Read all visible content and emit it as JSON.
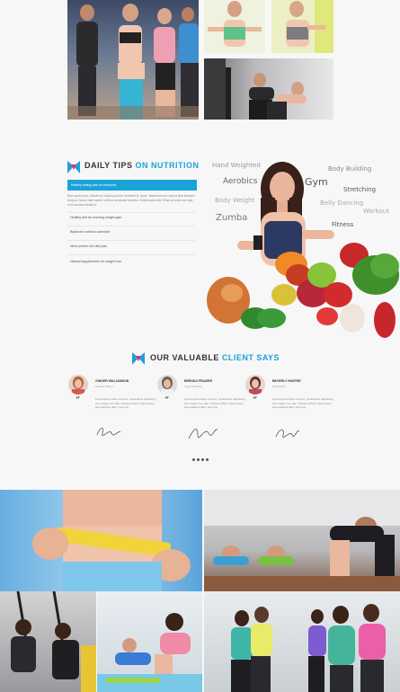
{
  "nutrition": {
    "heading_plain": "DAILY TIPS",
    "heading_accent": "ON NUTRITION",
    "active_tip": "Healthy eating plan for everyone",
    "paragraph": "Nam quam nunc, blandit vel, luctus pulvinar, hendrerit id, lorem. Maecenas nec odio et ante tincidunt tempus. Donec vitae sapien ut libero venenatis faucibus. Nullam quis ante. Etiam sit amet orci eget eros faucibus tincidunt.",
    "tips": [
      "Healthy diet for morning weight gain",
      "Balanced nutrition schedule",
      "Ideal protein rich diet plan",
      "Natural supplements for weight loss"
    ]
  },
  "tag_words": [
    "Hand Weighted",
    "Aerobics",
    "Gym",
    "Body Building",
    "Stretching",
    "Body Weight",
    "Belly Dancing",
    "Workout",
    "Zumba",
    "Fitness"
  ],
  "testimonials": {
    "heading_plain": "OUR VALUABLE",
    "heading_accent": "CLIENT SAYS",
    "items": [
      {
        "name": "GINGER WILLIAMSON",
        "role": "Fitness Trainer",
        "text": "Lorem ipsum dolor sit amet, consectetur adipiscing elit. Integer nec odio. Praesent libero. Sed cursus ante dapibus diam. Sed nisi."
      },
      {
        "name": "BRENDA FRAZIER",
        "role": "Yoga Instructor",
        "text": "Lorem ipsum dolor sit amet, consectetur adipiscing elit. Integer nec odio. Praesent libero. Sed cursus ante dapibus diam. Sed nisi."
      },
      {
        "name": "BEVERLY HUNTER",
        "role": "Nutritionist",
        "text": "Lorem ipsum dolor sit amet, consectetur adipiscing elit. Integer nec odio. Praesent libero. Sed cursus ante dapibus diam. Sed nisi."
      }
    ]
  },
  "colors": {
    "accent": "#1aa3d6",
    "background": "#f7f7f8"
  }
}
